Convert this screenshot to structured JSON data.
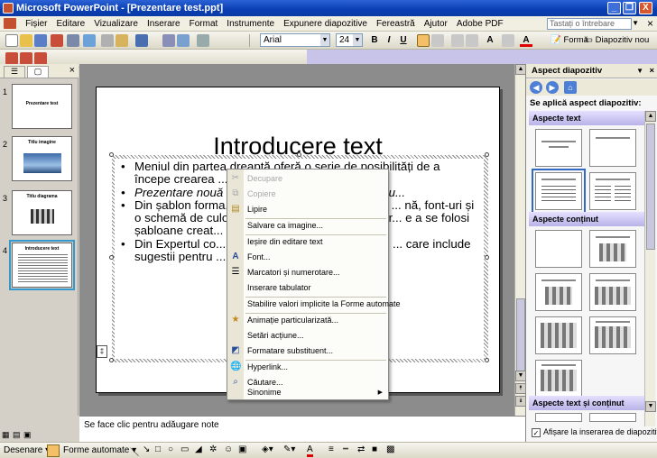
{
  "titlebar": {
    "title": "Microsoft PowerPoint - [Prezentare test.ppt]",
    "minimize": "_",
    "restore": "❐",
    "close": "X"
  },
  "menu": {
    "items": [
      "Fișier",
      "Editare",
      "Vizualizare",
      "Inserare",
      "Format",
      "Instrumente",
      "Expunere diapozitive",
      "Fereastră",
      "Ajutor",
      "Adobe PDF"
    ],
    "ask_placeholder": "Tastați o întrebare",
    "close": "×"
  },
  "format_toolbar": {
    "font": "Arial",
    "size": "24",
    "bold": "B",
    "italic": "I",
    "underline": "U",
    "format_label": "Formă",
    "new_slide_label": "Diapozitiv nou"
  },
  "left_panel": {
    "tab_outline": "☰",
    "tab_slides": "▢",
    "close": "×",
    "slides": [
      {
        "num": "1",
        "title": "Prezentare test"
      },
      {
        "num": "2",
        "title": "Titlu imagine"
      },
      {
        "num": "3",
        "title": "Titlu diagrama"
      },
      {
        "num": "4",
        "title": "Introducere text"
      }
    ]
  },
  "slide": {
    "title": "Introducere text",
    "bullets": [
      "Meniul din partea dreaptă oferă o serie de posibilități de a începe crearea ...",
      "Prezentare nouă ... cu un aspect minim și fără cu...",
      "Din șablon forma... pe un șablon PowerPoint ce ... nă, font-uri și o schemă de culo... loanele care însoțesc Power... e a se folosi șabloane creat...",
      "Din Expertul co... Se utilizează un Expert pentru ... care include sugestii pentru ... ale și se introduce textul..."
    ]
  },
  "notes": {
    "placeholder": "Se face clic pentru adăugare note"
  },
  "context_menu": {
    "items": [
      {
        "label": "Decupare",
        "enabled": false,
        "icon": "scissors-icon"
      },
      {
        "label": "Copiere",
        "enabled": false,
        "icon": "copy-icon"
      },
      {
        "label": "Lipire",
        "enabled": true,
        "icon": "paste-icon"
      },
      {
        "label": "Salvare ca imagine...",
        "enabled": true,
        "icon": ""
      },
      {
        "label": "Ieșire din editare text",
        "enabled": true,
        "icon": ""
      },
      {
        "label": "Font...",
        "enabled": true,
        "icon": "font-icon"
      },
      {
        "label": "Marcatori și numerotare...",
        "enabled": true,
        "icon": "bullets-icon"
      },
      {
        "label": "Inserare tabulator",
        "enabled": true,
        "icon": ""
      },
      {
        "label": "Stabilire valori implicite la Forme automate",
        "enabled": true,
        "icon": ""
      },
      {
        "label": "Animație particularizată...",
        "enabled": true,
        "icon": "animation-icon"
      },
      {
        "label": "Setări acțiune...",
        "enabled": true,
        "icon": ""
      },
      {
        "label": "Formatare substituent...",
        "enabled": true,
        "icon": "format-icon"
      },
      {
        "label": "Hyperlink...",
        "enabled": true,
        "icon": "hyperlink-icon"
      },
      {
        "label": "Căutare...",
        "enabled": true,
        "icon": "search-icon"
      },
      {
        "label": "Sinonime",
        "enabled": true,
        "icon": "",
        "submenu": true
      }
    ]
  },
  "task_pane": {
    "title": "Aspect diapozitiv",
    "apply_label": "Se aplică aspect diapozitiv:",
    "section_text": "Aspecte text",
    "section_content": "Aspecte conținut",
    "section_text_content": "Aspecte text și conținut",
    "show_on_insert": "Afișare la inserarea de diapozitive noi",
    "show_on_insert_checked": true
  },
  "drawing_toolbar": {
    "draw_label": "Desenare",
    "autoshapes_label": "Forme automate"
  },
  "colors": {
    "title_bar": "#0a3fb3",
    "selection": "#316ac5",
    "section_header": "#b9b3e8"
  }
}
